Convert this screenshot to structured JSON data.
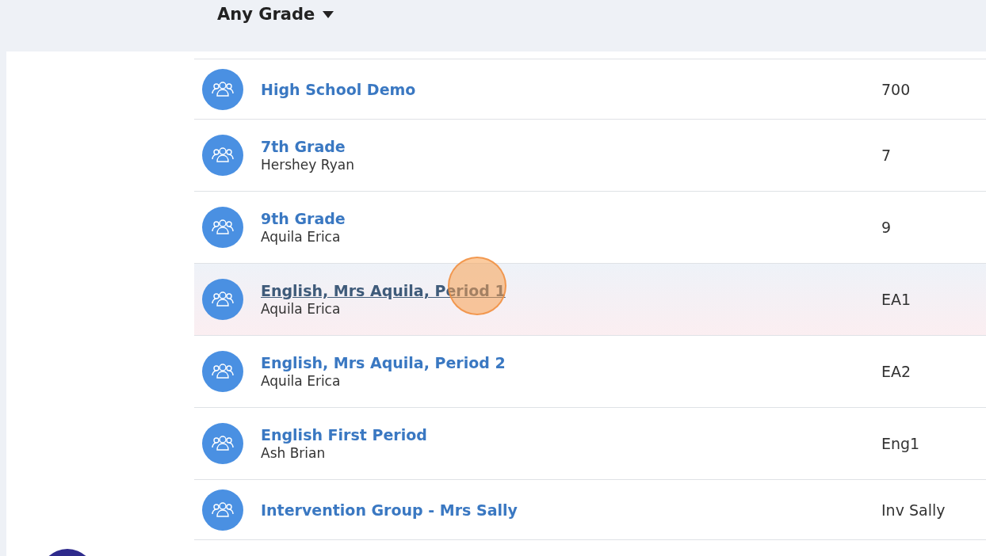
{
  "filter": {
    "label": "Any Grade"
  },
  "classes": [
    {
      "name": "High School Demo",
      "code": "700",
      "highlighted": false
    },
    {
      "name": "7th Grade",
      "teacher": "Hershey Ryan",
      "code": "7",
      "highlighted": false
    },
    {
      "name": "9th Grade",
      "teacher": "Aquila Erica",
      "code": "9",
      "highlighted": false
    },
    {
      "name": "English, Mrs Aquila, Period 1",
      "teacher": "Aquila Erica",
      "code": "EA1",
      "highlighted": true
    },
    {
      "name": "English, Mrs Aquila, Period 2",
      "teacher": "Aquila Erica",
      "code": "EA2",
      "highlighted": false
    },
    {
      "name": "English First Period",
      "teacher": "Ash Brian",
      "code": "Eng1",
      "highlighted": false
    },
    {
      "name": "Intervention Group - Mrs Sally",
      "code": "Inv Sally",
      "highlighted": false
    }
  ]
}
